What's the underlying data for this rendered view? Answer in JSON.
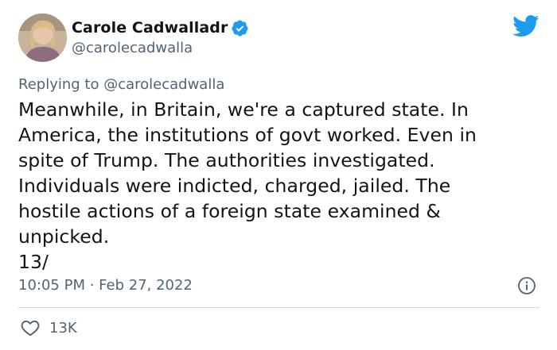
{
  "author": {
    "display_name": "Carole Cadwalladr",
    "handle": "@carolecadwalla",
    "verified_icon": "verified-badge-icon"
  },
  "brand": {
    "logo_icon": "twitter-bird-icon",
    "accent_color": "#1d9bf0"
  },
  "reply": {
    "prefix": "Replying to ",
    "handle": "@carolecadwalla"
  },
  "tweet": {
    "text": "Meanwhile, in Britain, we're a captured state. In\nAmerica, the institutions of govt worked. Even in\nspite of Trump. The authorities investigated.\nIndividuals were indicted, charged, jailed. The\nhostile actions of a foreign state examined &\nunpicked.\n13/",
    "timestamp": "10:05 PM · Feb 27, 2022"
  },
  "actions": {
    "like_icon": "heart-icon",
    "like_count": "13K",
    "info_icon": "info-icon"
  }
}
